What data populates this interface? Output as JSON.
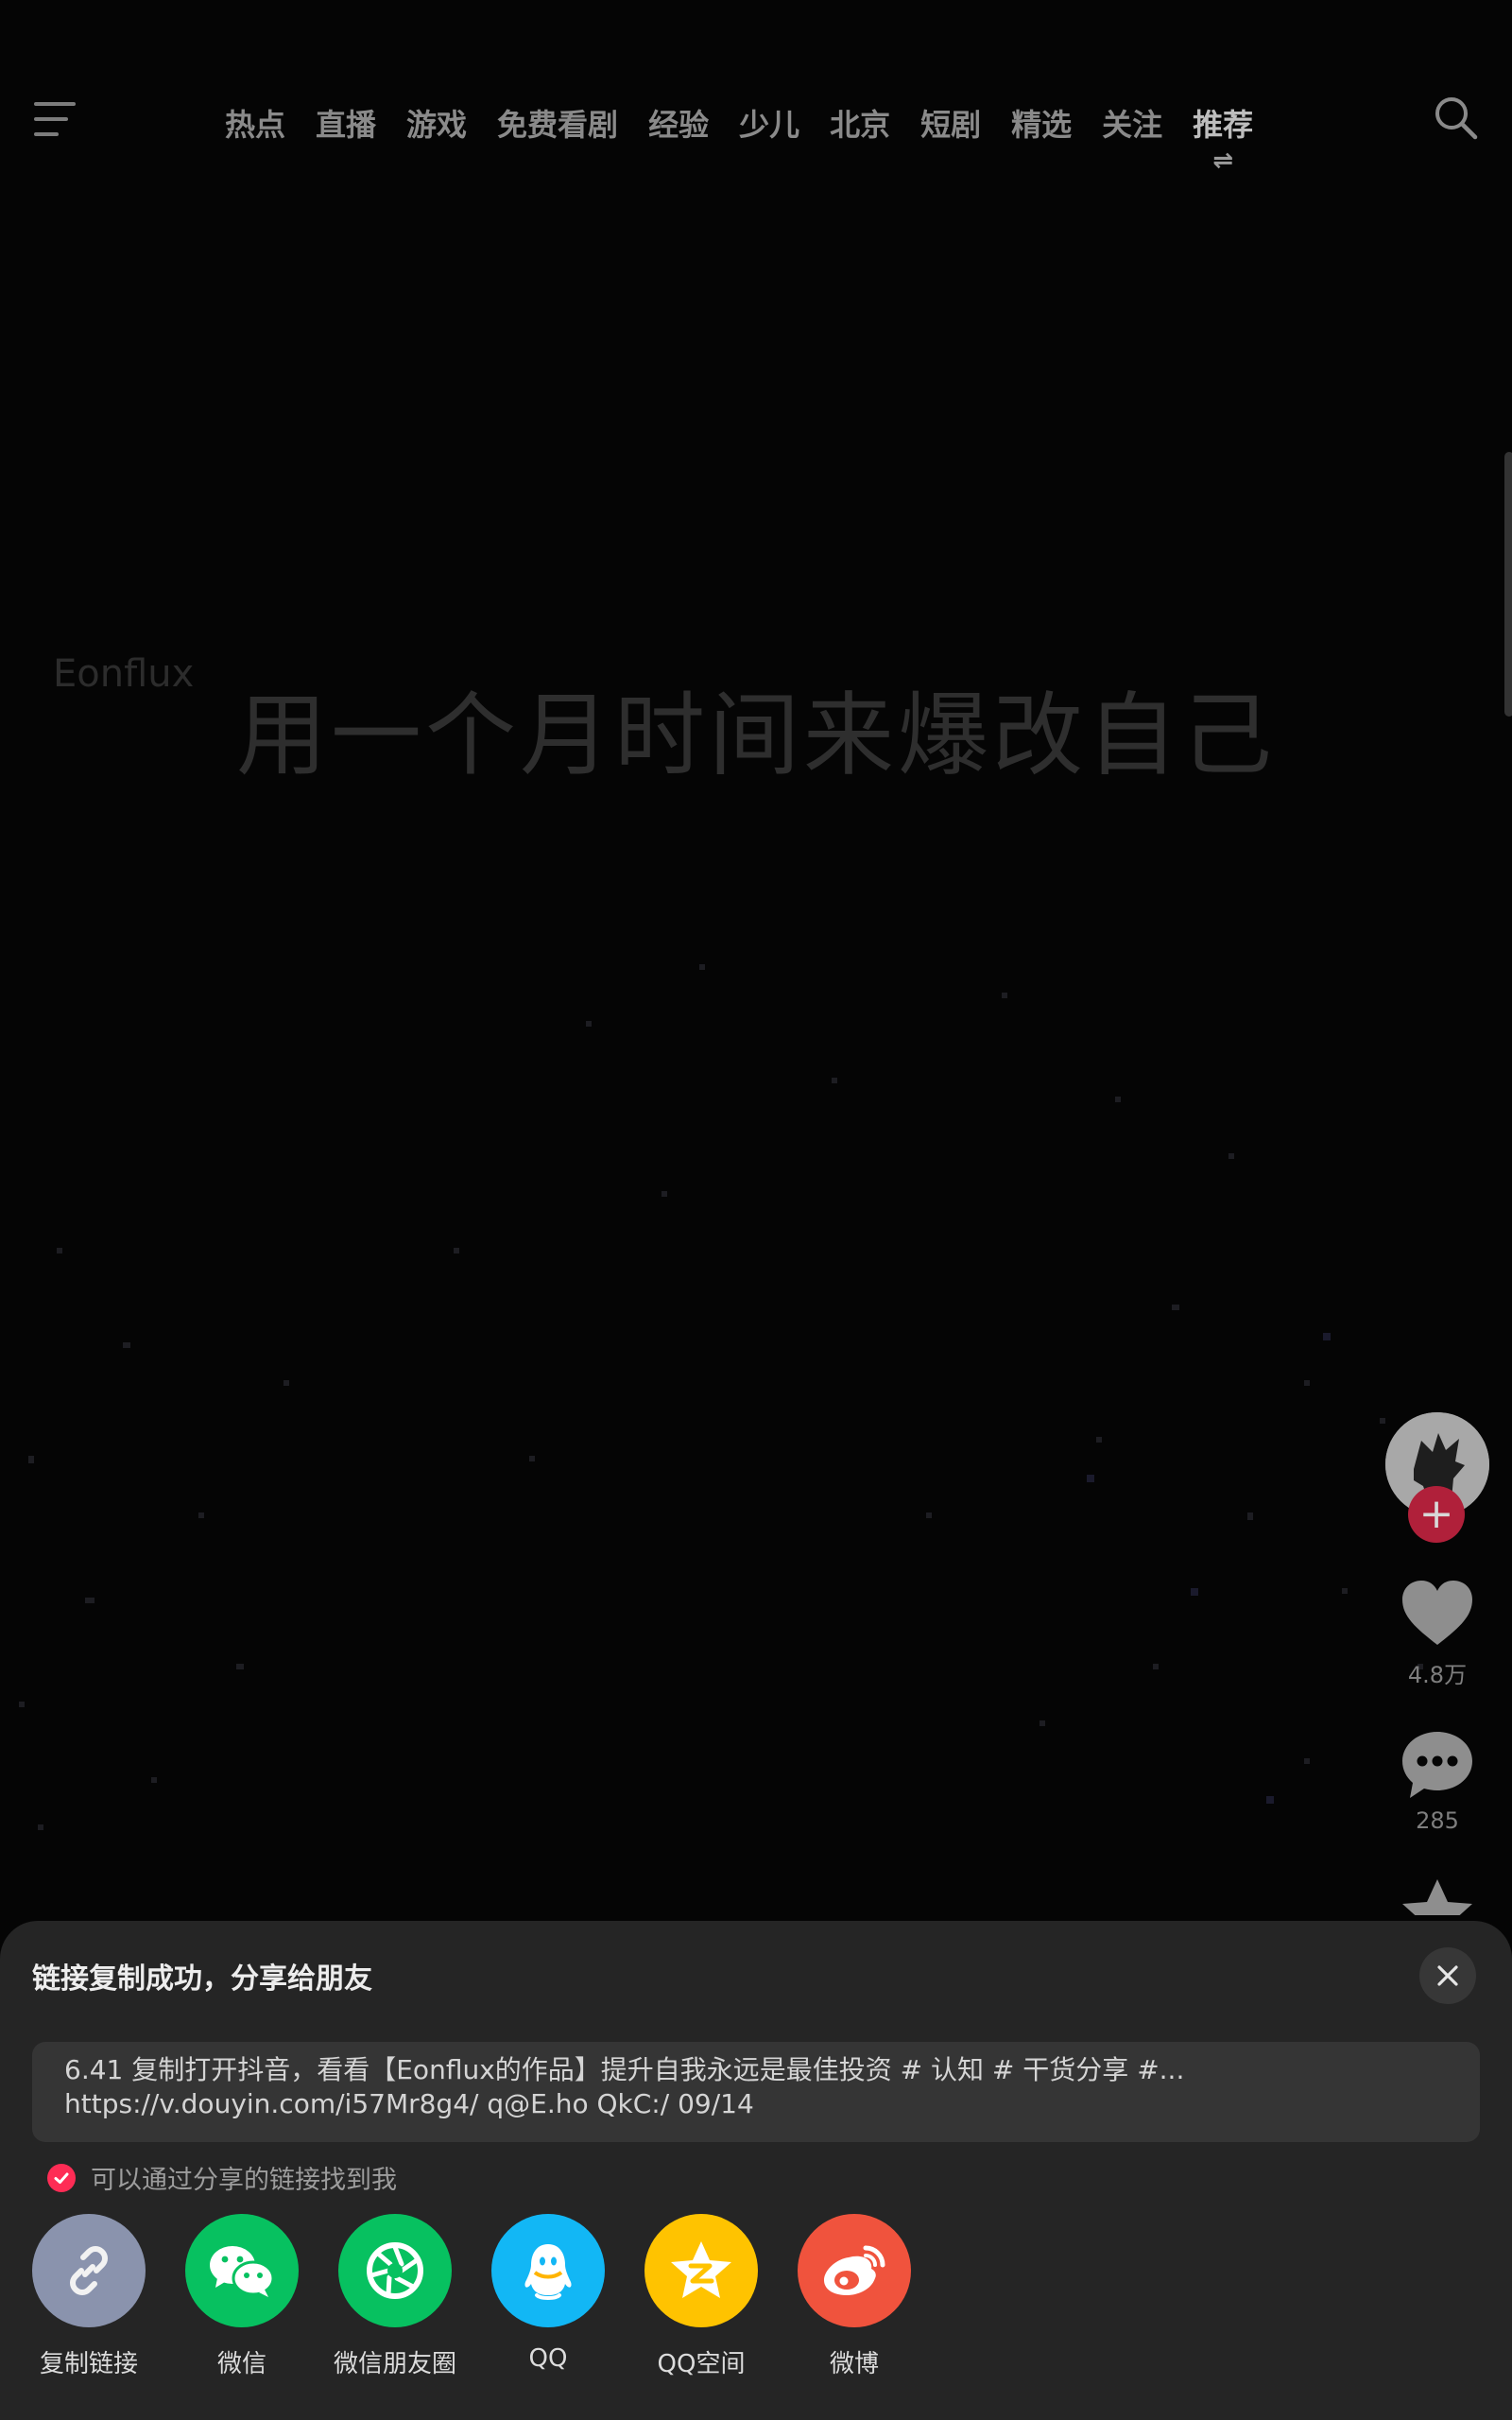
{
  "nav": {
    "tabs": [
      "热点",
      "直播",
      "游戏",
      "免费看剧",
      "经验",
      "少儿",
      "北京",
      "短剧",
      "精选",
      "关注",
      "推荐"
    ],
    "active_tab": "推荐",
    "active_tab_icon": "⇌",
    "menu_icon": "menu-icon",
    "search_icon": "search-icon"
  },
  "video": {
    "watermark": "Eonflux",
    "caption": "用一个月时间来爆改自己"
  },
  "actions": {
    "like_count": "4.8万",
    "comment_count": "285",
    "follow_symbol": "+"
  },
  "share_sheet": {
    "title": "链接复制成功，分享给朋友",
    "link_line1": "6.41 复制打开抖音，看看【Eonflux的作品】提升自我永远是最佳投资 # 认知 # 干货分享 #...",
    "link_line2": "https://v.douyin.com/i57Mr8g4/ q@E.ho QkC:/ 09/14",
    "checkbox_label": "可以通过分享的链接找到我",
    "checkbox_checked": true,
    "targets": [
      {
        "label": "复制链接",
        "icon": "link-icon",
        "color": "#8a93ad"
      },
      {
        "label": "微信",
        "icon": "wechat-icon",
        "color": "#07c160"
      },
      {
        "label": "微信朋友圈",
        "icon": "moments-icon",
        "color": "#07c160"
      },
      {
        "label": "QQ",
        "icon": "qq-icon",
        "color": "#12b7f5"
      },
      {
        "label": "QQ空间",
        "icon": "qzone-icon",
        "color": "#ffc300"
      },
      {
        "label": "微博",
        "icon": "weibo-icon",
        "color": "#f0533d"
      }
    ]
  },
  "colors": {
    "background": "#050505",
    "sheet": "#252525",
    "accent": "#fe2c55"
  }
}
